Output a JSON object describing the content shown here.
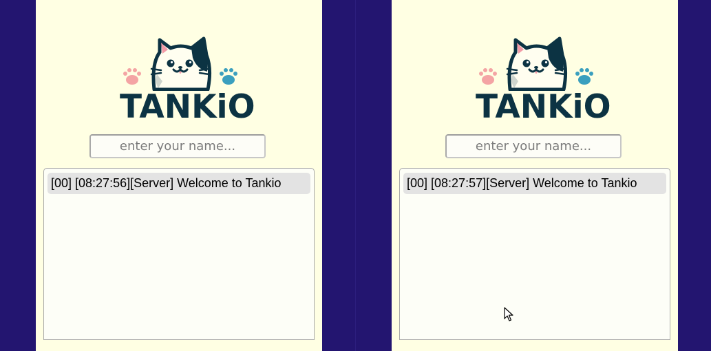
{
  "colors": {
    "outer_background": "#231570",
    "panel_background": "#ffffe3",
    "logo_text": "#0c3343",
    "paw_pink": "#f4a4a4",
    "paw_teal": "#3a9fbe",
    "message_background": "#e3e3e3"
  },
  "panels": [
    {
      "logo_text": "TANKiO",
      "name_input": {
        "placeholder": "enter your name...",
        "value": ""
      },
      "chat_messages": [
        {
          "text": "[00] [08:27:56][Server] Welcome to Tankio"
        }
      ]
    },
    {
      "logo_text": "TANKiO",
      "name_input": {
        "placeholder": "enter your name...",
        "value": ""
      },
      "chat_messages": [
        {
          "text": "[00] [08:27:57][Server] Welcome to Tankio"
        }
      ]
    }
  ],
  "icons": {
    "logo": "cat-logo-icon",
    "left_paw": "paw-icon",
    "right_paw": "paw-icon",
    "pointer": "mouse-pointer-icon"
  }
}
